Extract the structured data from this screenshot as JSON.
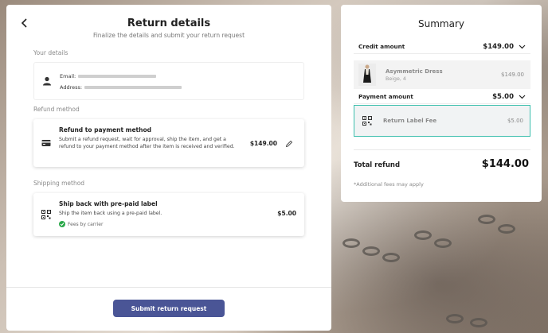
{
  "main": {
    "title": "Return details",
    "subtitle": "Finalize the details and submit your return request",
    "your_details_label": "Your details",
    "email_label": "Email:",
    "address_label": "Address:",
    "refund_method_label": "Refund method",
    "refund_card": {
      "title": "Refund to payment method",
      "description": "Submit a refund request, wait for approval, ship the item, and get a refund to your payment method after the item is received and verified.",
      "price": "$149.00"
    },
    "shipping_method_label": "Shipping method",
    "ship_card": {
      "title": "Ship back with pre-paid label",
      "description": "Ship the item back using a pre-paid label.",
      "fees": "Fees by carrier",
      "price": "$5.00"
    },
    "submit_label": "Submit return request"
  },
  "summary": {
    "title": "Summary",
    "credit_label": "Credit amount",
    "credit_amount": "$149.00",
    "item": {
      "name": "Asymmetric Dress",
      "variant": "Beige, 4",
      "price": "$149.00"
    },
    "payment_label": "Payment amount",
    "payment_amount": "$5.00",
    "fee": {
      "name": "Return Label Fee",
      "price": "$5.00"
    },
    "total_label": "Total refund",
    "total_amount": "$144.00",
    "note": "*Additional fees may apply"
  },
  "colors": {
    "button": "#4a5596",
    "highlight": "#3cbfad",
    "check": "#2aa84a"
  },
  "icons": [
    "back-arrow-icon",
    "person-icon",
    "credit-card-icon",
    "edit-pencil-icon",
    "qr-code-icon",
    "check-circle-icon",
    "chevron-down-icon"
  ]
}
